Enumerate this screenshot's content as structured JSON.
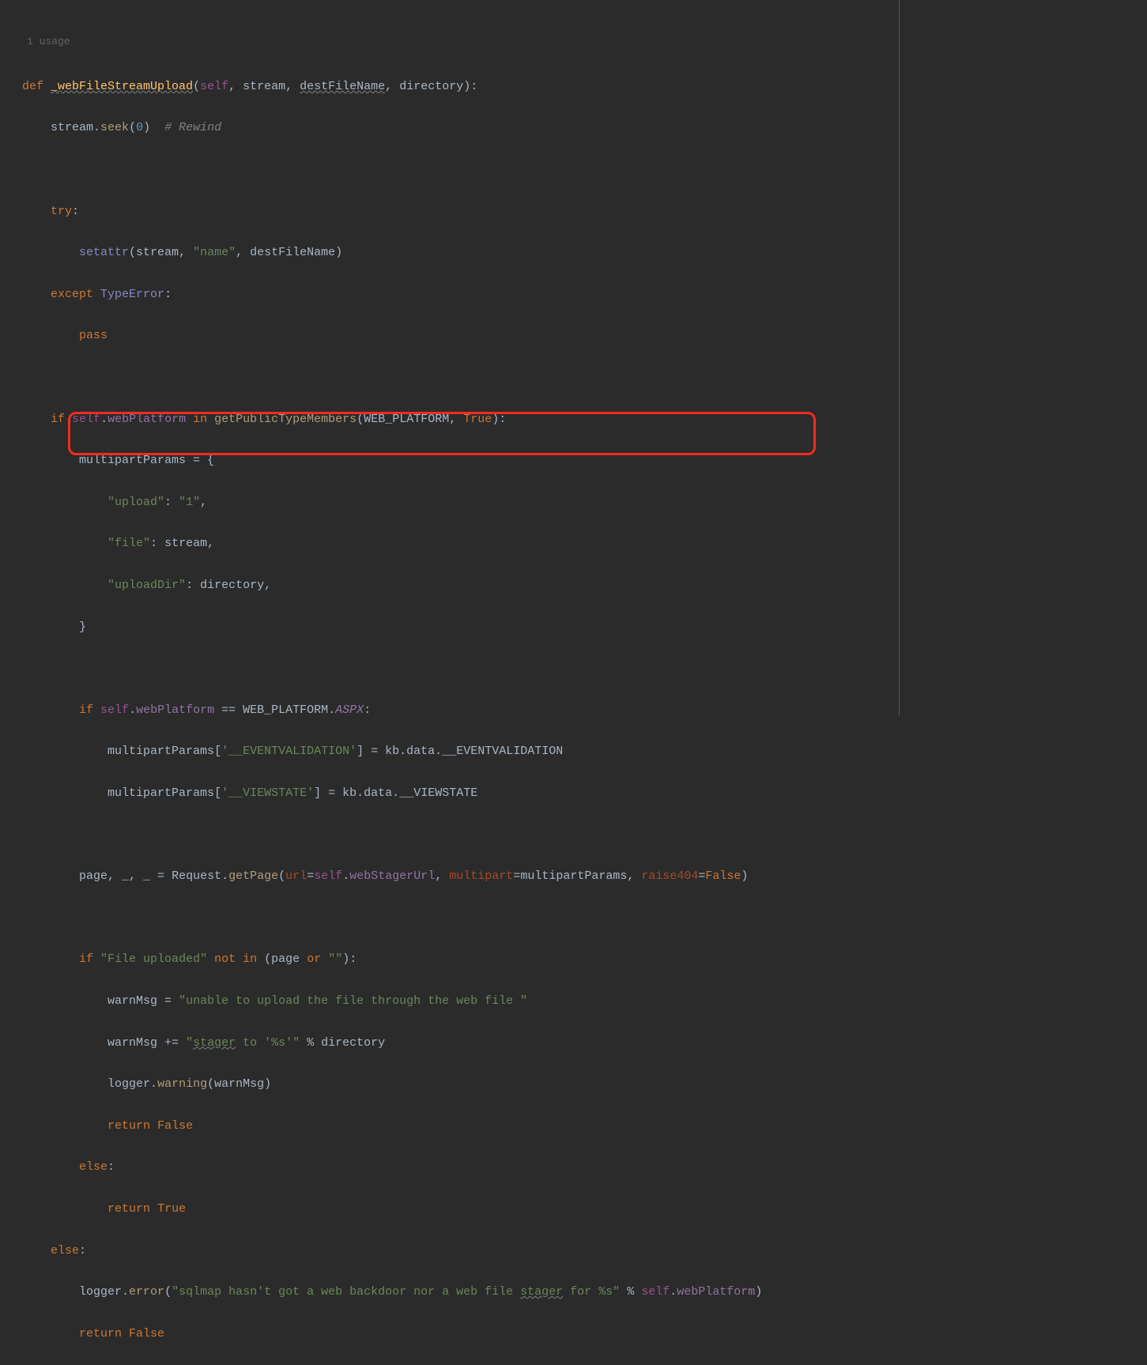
{
  "usage": "1 usage",
  "tokens": {
    "def": "def",
    "funcName": "_webFileStreamUpload",
    "self": "self",
    "stream": "stream",
    "destFileName": "destFileName",
    "directory": "directory",
    "seek": "seek",
    "zero": "0",
    "rewind_comment": "# Rewind",
    "try": "try",
    "setattr": "setattr",
    "name_str": "\"name\"",
    "except": "except",
    "TypeError": "TypeError",
    "pass": "pass",
    "if": "if",
    "webPlatform": "webPlatform",
    "in": "in",
    "getPublicTypeMembers": "getPublicTypeMembers",
    "WEB_PLATFORM": "WEB_PLATFORM",
    "True": "True",
    "multipartParams": "multipartParams",
    "upload_str": "\"upload\"",
    "one_str": "\"1\"",
    "file_str": "\"file\"",
    "uploadDir_str": "\"uploadDir\"",
    "ASPX": "ASPX",
    "eventVal_str": "'__EVENTVALIDATION'",
    "kb": "kb",
    "data": "data",
    "EVENTVALIDATION": "__EVENTVALIDATION",
    "viewstate_str": "'__VIEWSTATE'",
    "VIEWSTATE": "__VIEWSTATE",
    "page": "page",
    "underscore": "_",
    "Request": "Request",
    "getPage": "getPage",
    "url_kw": "url",
    "webStagerUrl": "webStagerUrl",
    "multipart_kw": "multipart",
    "raise404_kw": "raise404",
    "False": "False",
    "fileUploaded_str": "\"File uploaded\"",
    "not": "not",
    "or": "or",
    "empty_str": "\"\"",
    "warnMsg": "warnMsg",
    "warn_str1": "\"unable to upload the file through the web file \"",
    "warn_str2_a": "\"",
    "warn_str2_stager": "stager",
    "warn_str2_b": " to '%s'\"",
    "logger": "logger",
    "warning": "warning",
    "return": "return",
    "else": "else",
    "error": "error",
    "err_str_a": "\"sqlmap hasn't got a web backdoor nor a web file ",
    "err_str_stager": "stager",
    "err_str_b": " for %s\""
  }
}
